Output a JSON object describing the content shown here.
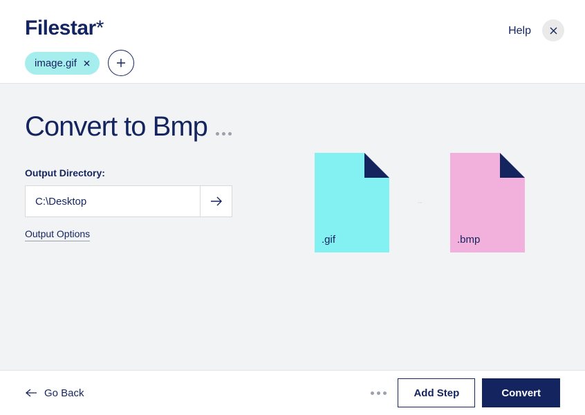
{
  "app": {
    "name": "Filestar",
    "star": "*"
  },
  "header": {
    "help_label": "Help",
    "file_chip": "image.gif"
  },
  "main": {
    "title": "Convert to Bmp",
    "output_label": "Output Directory:",
    "output_path": "C:\\Desktop",
    "options_link": "Output Options",
    "source_ext": ".gif",
    "target_ext": ".bmp"
  },
  "footer": {
    "back_label": "Go Back",
    "addstep_label": "Add Step",
    "convert_label": "Convert"
  },
  "colors": {
    "source_fill": "#83F1F1",
    "target_fill": "#F1B1DC",
    "navy": "#14245F"
  }
}
